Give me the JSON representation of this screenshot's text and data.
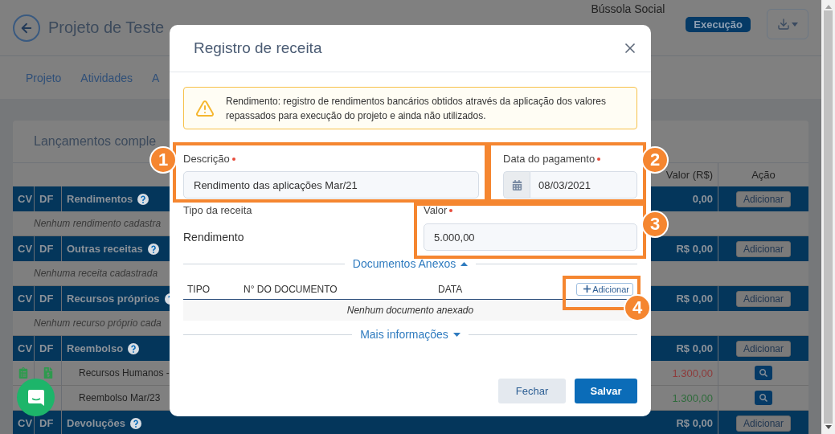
{
  "header": {
    "title": "Projeto de Teste",
    "organization": "Bússola Social",
    "status": "Execução"
  },
  "nav_tabs": [
    "Projeto",
    "Atividades",
    "A"
  ],
  "card": {
    "title": "Lançamentos comple",
    "columns": [
      "Valor (R$)",
      "Ação"
    ],
    "rows": [
      {
        "kind": "group",
        "cv": "CV",
        "df": "DF",
        "name": "Rendimentos",
        "value": "0,00",
        "action": "Adicionar"
      },
      {
        "kind": "empty",
        "text": "Nenhum rendimento cadastra"
      },
      {
        "kind": "group",
        "cv": "CV",
        "df": "DF",
        "name": "Outras receitas",
        "value": "R$ 0,00",
        "action": "Adicionar"
      },
      {
        "kind": "empty",
        "text": "Nenhuma receita cadastrada"
      },
      {
        "kind": "group",
        "cv": "CV",
        "df": "DF",
        "name": "Recursos próprios",
        "value": "R$ 0,00",
        "action": "Adicionar"
      },
      {
        "kind": "empty",
        "text": "Nenhum recurso próprio cada"
      },
      {
        "kind": "group",
        "cv": "CV",
        "df": "DF",
        "name": "Reembolso",
        "value": "R$ 0,00",
        "action": "Adicionar"
      },
      {
        "kind": "item",
        "name": "Recursos Humanos -",
        "value": "1.300,00",
        "color": "#8e3a3a"
      },
      {
        "kind": "item",
        "name": "Reembolso Mar/23",
        "value": "1.300,00",
        "color": "#2e6b3b"
      },
      {
        "kind": "group",
        "cv": "CV",
        "df": "DF",
        "name": "Devoluções",
        "value": "R$ 0,00",
        "action": "Adicionar"
      }
    ]
  },
  "modal": {
    "title": "Registro de receita",
    "alert": "Rendimento: registro de rendimentos bancários obtidos através da aplicação dos valores repassados para execução do projeto e ainda não utilizados.",
    "description": {
      "label": "Descrição",
      "required": true,
      "value": "Rendimento das aplicações Mar/21"
    },
    "payment_date": {
      "label": "Data do pagamento",
      "required": true,
      "value": "08/03/2021"
    },
    "revenue_type": {
      "label": "Tipo da receita",
      "value": "Rendimento"
    },
    "amount": {
      "label": "Valor",
      "required": true,
      "value": "5.000,00"
    },
    "documents": {
      "title": "Documentos Anexos",
      "expanded": true,
      "columns": [
        "TIPO",
        "N° DO DOCUMENTO",
        "DATA"
      ],
      "add_button": "Adicionar",
      "empty": "Nenhum documento anexado"
    },
    "more_info": {
      "title": "Mais informações",
      "expanded": false
    },
    "buttons": [
      {
        "kind": "secondary",
        "label": "Fechar"
      },
      {
        "kind": "primary",
        "label": "Salvar"
      }
    ]
  },
  "annotations": [
    {
      "number": "1"
    },
    {
      "number": "2"
    },
    {
      "number": "3"
    },
    {
      "number": "4"
    }
  ]
}
